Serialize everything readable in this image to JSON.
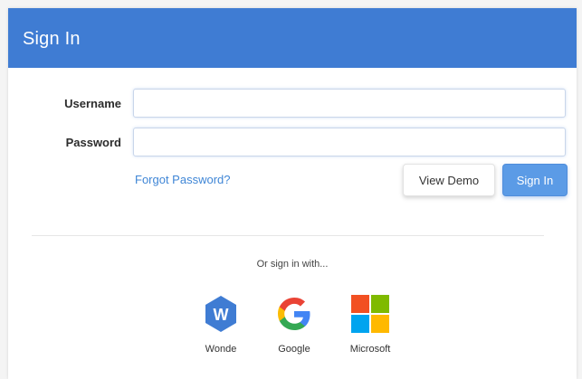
{
  "header": {
    "title": "Sign In"
  },
  "form": {
    "username_label": "Username",
    "username_value": "",
    "password_label": "Password",
    "password_value": "",
    "forgot_link": "Forgot Password?",
    "view_demo_label": "View Demo",
    "sign_in_label": "Sign In"
  },
  "social": {
    "intro": "Or sign in with...",
    "providers": [
      {
        "label": "Wonde",
        "icon": "wonde-logo-icon"
      },
      {
        "label": "Google",
        "icon": "google-logo-icon"
      },
      {
        "label": "Microsoft",
        "icon": "microsoft-logo-icon"
      }
    ]
  },
  "colors": {
    "header": "#3f7cd3",
    "link": "#3f86d6",
    "primary_button": "#5b9be6"
  }
}
